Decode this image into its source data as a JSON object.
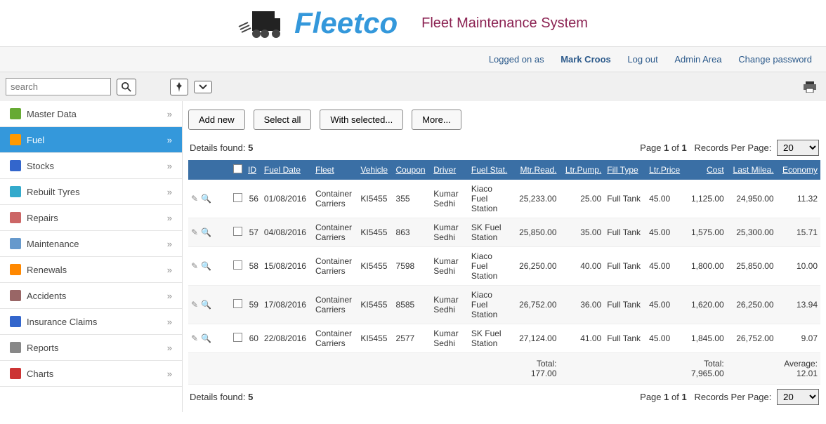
{
  "header": {
    "brand": "Fleetco",
    "subtitle": "Fleet Maintenance System"
  },
  "userbar": {
    "logged_prefix": "Logged on as ",
    "username": "Mark Croos",
    "logout": "Log out",
    "admin": "Admin Area",
    "change_pw": "Change password"
  },
  "search": {
    "placeholder": "search"
  },
  "sidebar": {
    "items": [
      {
        "label": "Master Data"
      },
      {
        "label": "Fuel"
      },
      {
        "label": "Stocks"
      },
      {
        "label": "Rebuilt Tyres"
      },
      {
        "label": "Repairs"
      },
      {
        "label": "Maintenance"
      },
      {
        "label": "Renewals"
      },
      {
        "label": "Accidents"
      },
      {
        "label": "Insurance Claims"
      },
      {
        "label": "Reports"
      },
      {
        "label": "Charts"
      }
    ]
  },
  "actions": {
    "add": "Add new",
    "select_all": "Select all",
    "with_selected": "With selected...",
    "more": "More..."
  },
  "pager": {
    "details_prefix": "Details found: ",
    "details_count": "5",
    "page_prefix": "Page ",
    "page_cur": "1",
    "page_of": " of ",
    "page_total": "1",
    "rpp_label": "Records Per Page:",
    "rpp_value": "20"
  },
  "columns": {
    "id": "ID",
    "fuel_date": "Fuel Date",
    "fleet": "Fleet",
    "vehicle": "Vehicle",
    "coupon": "Coupon",
    "driver": "Driver",
    "fuel_stat": "Fuel Stat.",
    "mtr_read": "Mtr.Read.",
    "ltr_pump": "Ltr.Pump.",
    "fill_type": "Fill Type",
    "ltr_price": "Ltr.Price",
    "cost": "Cost",
    "last_milea": "Last Milea.",
    "economy": "Economy"
  },
  "rows": [
    {
      "id": "56",
      "date": "01/08/2016",
      "fleet": "Container Carriers",
      "vehicle": "KI5455",
      "coupon": "355",
      "driver": "Kumar Sedhi",
      "station": "Kiaco Fuel Station",
      "mtr": "25,233.00",
      "ltr": "25.00",
      "fill": "Full Tank",
      "price": "45.00",
      "cost": "1,125.00",
      "last": "24,950.00",
      "econ": "11.32"
    },
    {
      "id": "57",
      "date": "04/08/2016",
      "fleet": "Container Carriers",
      "vehicle": "KI5455",
      "coupon": "863",
      "driver": "Kumar Sedhi",
      "station": "SK Fuel Station",
      "mtr": "25,850.00",
      "ltr": "35.00",
      "fill": "Full Tank",
      "price": "45.00",
      "cost": "1,575.00",
      "last": "25,300.00",
      "econ": "15.71"
    },
    {
      "id": "58",
      "date": "15/08/2016",
      "fleet": "Container Carriers",
      "vehicle": "KI5455",
      "coupon": "7598",
      "driver": "Kumar Sedhi",
      "station": "Kiaco Fuel Station",
      "mtr": "26,250.00",
      "ltr": "40.00",
      "fill": "Full Tank",
      "price": "45.00",
      "cost": "1,800.00",
      "last": "25,850.00",
      "econ": "10.00"
    },
    {
      "id": "59",
      "date": "17/08/2016",
      "fleet": "Container Carriers",
      "vehicle": "KI5455",
      "coupon": "8585",
      "driver": "Kumar Sedhi",
      "station": "Kiaco Fuel Station",
      "mtr": "26,752.00",
      "ltr": "36.00",
      "fill": "Full Tank",
      "price": "45.00",
      "cost": "1,620.00",
      "last": "26,250.00",
      "econ": "13.94"
    },
    {
      "id": "60",
      "date": "22/08/2016",
      "fleet": "Container Carriers",
      "vehicle": "KI5455",
      "coupon": "2577",
      "driver": "Kumar Sedhi",
      "station": "SK Fuel Station",
      "mtr": "27,124.00",
      "ltr": "41.00",
      "fill": "Full Tank",
      "price": "45.00",
      "cost": "1,845.00",
      "last": "26,752.00",
      "econ": "9.07"
    }
  ],
  "totals": {
    "ltr_label": "Total:",
    "ltr_val": "177.00",
    "cost_label": "Total:",
    "cost_val": "7,965.00",
    "econ_label": "Average:",
    "econ_val": "12.01"
  }
}
